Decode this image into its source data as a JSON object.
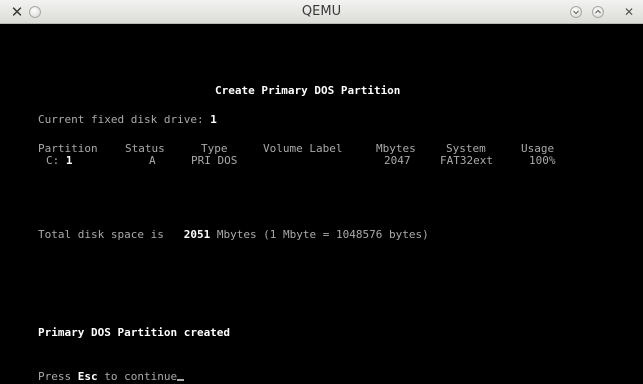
{
  "window": {
    "title": "QEMU"
  },
  "icons": {
    "app": "qemu-x-icon",
    "stick": "stick-icon",
    "minimize": "minimize-icon",
    "maximize": "maximize-icon",
    "close": "close-icon"
  },
  "console": {
    "heading": "Create Primary DOS Partition",
    "drive_label": "Current fixed disk drive: ",
    "drive_value": "1",
    "table": {
      "headers": [
        "Partition",
        "Status",
        "Type",
        "Volume Label",
        "Mbytes",
        "System",
        "Usage"
      ],
      "rows": [
        {
          "partition_prefix": "C: ",
          "partition_num": "1",
          "status": "A",
          "type": "PRI DOS",
          "volume_label": "",
          "mbytes": "2047",
          "system": "FAT32ext",
          "usage": "100%"
        }
      ]
    },
    "total_label": "Total disk space is ",
    "total_value": "2051",
    "total_suffix": " Mbytes (1 Mbyte = 1048576 bytes)",
    "message": "Primary DOS Partition created",
    "prompt_prefix": "Press ",
    "prompt_key": "Esc",
    "prompt_suffix": " to continue"
  },
  "colors": {
    "background": "#000000",
    "text": "#aaaaaa",
    "bright": "#ffffff"
  }
}
